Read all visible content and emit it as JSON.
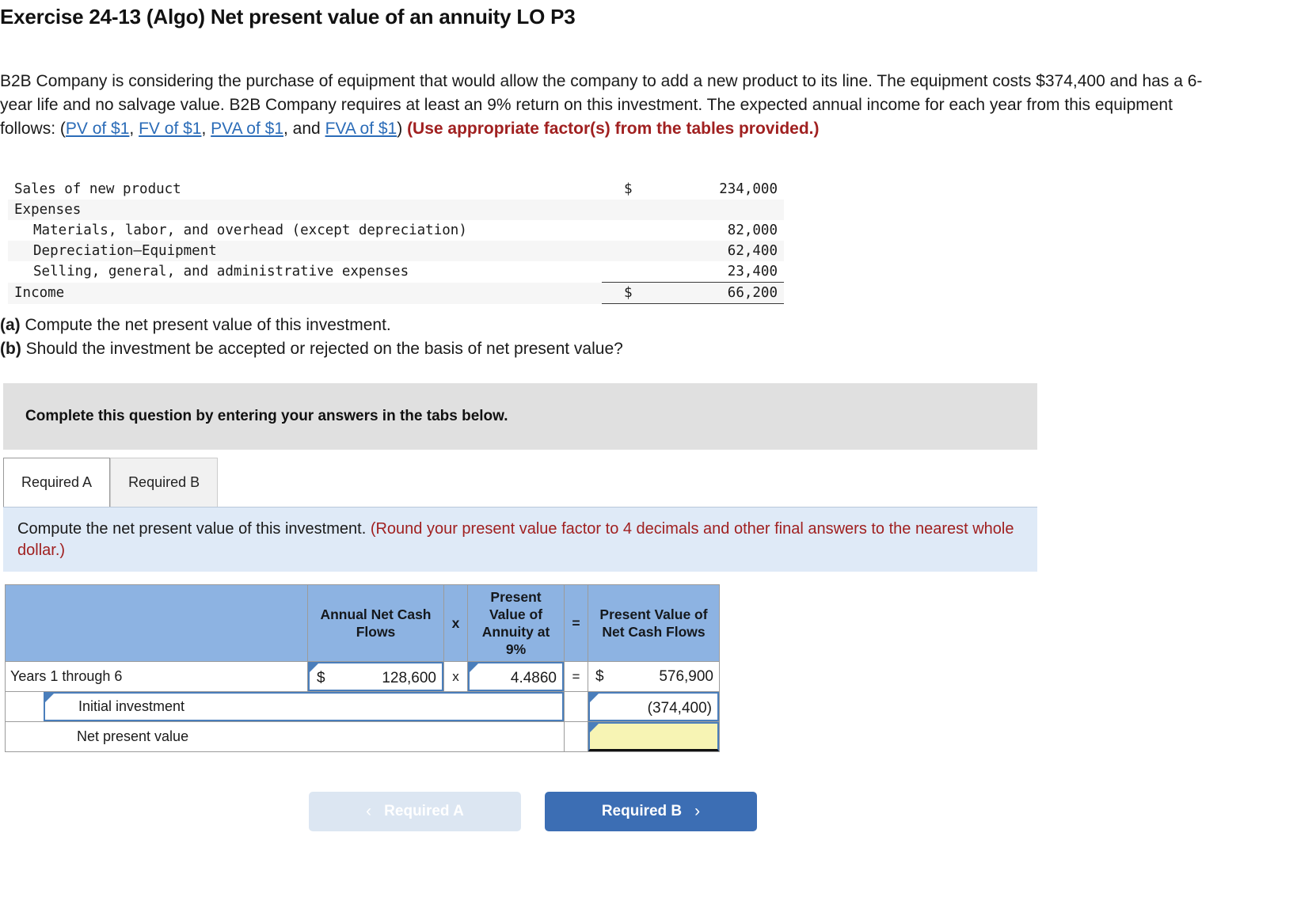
{
  "exercise": {
    "title": "Exercise 24-13 (Algo) Net present value of an annuity LO P3"
  },
  "problem": {
    "text_part1": "B2B Company is considering the purchase of equipment that would allow the company to add a new product to its line. The equipment costs $374,400 and has a 6-year life and no salvage value. B2B Company requires at least an 9% return on this investment. The expected annual income for each year from this equipment follows: (",
    "link_pv": "PV of $1",
    "sep1": ", ",
    "link_fv": "FV of $1",
    "sep2": ", ",
    "link_pva": "PVA of $1",
    "sep3": ", and ",
    "link_fva": "FVA of $1",
    "after_links": ") ",
    "bold_note": "(Use appropriate factor(s) from the tables provided.)"
  },
  "income_statement": {
    "rows": [
      {
        "label": "Sales of new product",
        "indent": 0,
        "dollar": "$",
        "amount": "234,000",
        "rule": "none",
        "zebra": false
      },
      {
        "label": "Expenses",
        "indent": 0,
        "dollar": "",
        "amount": "",
        "rule": "none",
        "zebra": true
      },
      {
        "label": "Materials, labor, and overhead (except depreciation)",
        "indent": 1,
        "dollar": "",
        "amount": "82,000",
        "rule": "none",
        "zebra": false
      },
      {
        "label": "Depreciation—Equipment",
        "indent": 1,
        "dollar": "",
        "amount": "62,400",
        "rule": "none",
        "zebra": true
      },
      {
        "label": "Selling, general, and administrative expenses",
        "indent": 1,
        "dollar": "",
        "amount": "23,400",
        "rule": "subtotal",
        "zebra": false
      },
      {
        "label": "Income",
        "indent": 0,
        "dollar": "$",
        "amount": "66,200",
        "rule": "total",
        "zebra": true
      }
    ]
  },
  "requirements": {
    "a_tag": "(a)",
    "a_text": " Compute the net present value of this investment.",
    "b_tag": "(b)",
    "b_text": " Should the investment be accepted or rejected on the basis of net present value?"
  },
  "banner": {
    "text": "Complete this question by entering your answers in the tabs below."
  },
  "tabs": [
    {
      "label": "Required A",
      "active": true
    },
    {
      "label": "Required B",
      "active": false
    }
  ],
  "instruction": {
    "main": "Compute the net present value of this investment. ",
    "hint": "(Round your present value factor to 4 decimals and other final answers to the nearest whole dollar.)"
  },
  "answer_grid": {
    "headers": {
      "blank": "",
      "cash_flows": "Annual Net Cash Flows",
      "times": "x",
      "factor": "Present Value of Annuity at 9%",
      "equals": "=",
      "present_value": "Present Value of Net Cash Flows"
    },
    "rows": [
      {
        "label": "Years 1 through 6",
        "cash_currency": "$",
        "cash_value": "128,600",
        "op_times": "x",
        "factor_value": "4.4860",
        "op_equals": "=",
        "pv_currency": "$",
        "pv_value": "576,900"
      },
      {
        "label": "Initial investment",
        "pv_value": "(374,400)"
      },
      {
        "label": "Net present value",
        "pv_value": ""
      }
    ]
  },
  "navigation": {
    "prev_label": "Required A",
    "prev_chevron": "‹",
    "next_label": "Required B",
    "next_chevron": "›"
  },
  "colors": {
    "header_blue": "#8db3e2",
    "instruction_blue": "#dfeaf7",
    "banner_gray": "#e0e0e0",
    "hint_red": "#a02020",
    "link_blue": "#2b6cb8",
    "input_border": "#4a7ebb",
    "input_yellow": "#f7f4b4",
    "next_button": "#3c6eb4",
    "prev_button": "#dce6f2"
  }
}
